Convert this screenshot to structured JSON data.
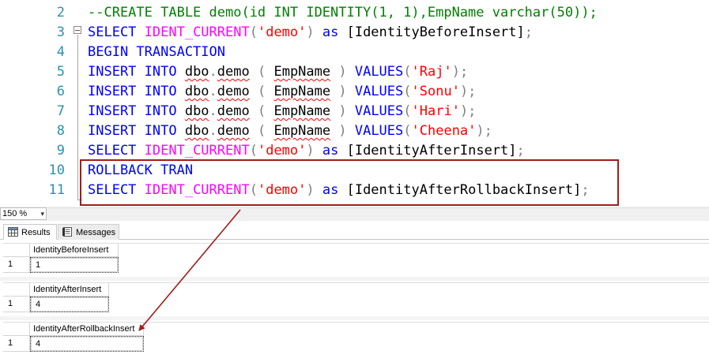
{
  "editor": {
    "lines": [
      {
        "num": "2",
        "tokens": [
          {
            "t": "--CREATE TABLE demo(id INT IDENTITY(1, 1),EmpName varchar(50));",
            "c": "cm"
          }
        ]
      },
      {
        "num": "3",
        "tokens": [
          {
            "t": "SELECT ",
            "c": "kw"
          },
          {
            "t": "IDENT_CURRENT",
            "c": "fn"
          },
          {
            "t": "(",
            "c": "op"
          },
          {
            "t": "'demo'",
            "c": "str"
          },
          {
            "t": ") ",
            "c": "op"
          },
          {
            "t": "as ",
            "c": "kw"
          },
          {
            "t": "[IdentityBeforeInsert]",
            "c": ""
          },
          {
            "t": ";",
            "c": "op"
          }
        ]
      },
      {
        "num": "4",
        "tokens": [
          {
            "t": "BEGIN TRANSACTION",
            "c": "kw"
          }
        ]
      },
      {
        "num": "5",
        "tokens": [
          {
            "t": "INSERT INTO ",
            "c": "kw"
          },
          {
            "t": "dbo",
            "c": "sq"
          },
          {
            "t": ".",
            "c": "op"
          },
          {
            "t": "demo",
            "c": "sq"
          },
          {
            "t": " ( ",
            "c": "op"
          },
          {
            "t": "EmpName",
            "c": "sq"
          },
          {
            "t": " ) ",
            "c": "op"
          },
          {
            "t": "VALUES",
            "c": "kw"
          },
          {
            "t": "(",
            "c": "op"
          },
          {
            "t": "'Raj'",
            "c": "str"
          },
          {
            "t": ");",
            "c": "op"
          }
        ]
      },
      {
        "num": "6",
        "tokens": [
          {
            "t": "INSERT INTO ",
            "c": "kw"
          },
          {
            "t": "dbo",
            "c": "sq"
          },
          {
            "t": ".",
            "c": "op"
          },
          {
            "t": "demo",
            "c": "sq"
          },
          {
            "t": " ( ",
            "c": "op"
          },
          {
            "t": "EmpName",
            "c": "sq"
          },
          {
            "t": " ) ",
            "c": "op"
          },
          {
            "t": "VALUES",
            "c": "kw"
          },
          {
            "t": "(",
            "c": "op"
          },
          {
            "t": "'Sonu'",
            "c": "str"
          },
          {
            "t": ");",
            "c": "op"
          }
        ]
      },
      {
        "num": "7",
        "tokens": [
          {
            "t": "INSERT INTO ",
            "c": "kw"
          },
          {
            "t": "dbo",
            "c": "sq"
          },
          {
            "t": ".",
            "c": "op"
          },
          {
            "t": "demo",
            "c": "sq"
          },
          {
            "t": " ( ",
            "c": "op"
          },
          {
            "t": "EmpName",
            "c": "sq"
          },
          {
            "t": " ) ",
            "c": "op"
          },
          {
            "t": "VALUES",
            "c": "kw"
          },
          {
            "t": "(",
            "c": "op"
          },
          {
            "t": "'Hari'",
            "c": "str"
          },
          {
            "t": ");",
            "c": "op"
          }
        ]
      },
      {
        "num": "8",
        "tokens": [
          {
            "t": "INSERT INTO ",
            "c": "kw"
          },
          {
            "t": "dbo",
            "c": "sq"
          },
          {
            "t": ".",
            "c": "op"
          },
          {
            "t": "demo",
            "c": "sq"
          },
          {
            "t": " ( ",
            "c": "op"
          },
          {
            "t": "EmpName",
            "c": "sq"
          },
          {
            "t": " ) ",
            "c": "op"
          },
          {
            "t": "VALUES",
            "c": "kw"
          },
          {
            "t": "(",
            "c": "op"
          },
          {
            "t": "'Cheena'",
            "c": "str"
          },
          {
            "t": ");",
            "c": "op"
          }
        ]
      },
      {
        "num": "9",
        "tokens": [
          {
            "t": "SELECT ",
            "c": "kw"
          },
          {
            "t": "IDENT_CURRENT",
            "c": "fn"
          },
          {
            "t": "(",
            "c": "op"
          },
          {
            "t": "'demo'",
            "c": "str"
          },
          {
            "t": ") ",
            "c": "op"
          },
          {
            "t": "as ",
            "c": "kw"
          },
          {
            "t": "[IdentityAfterInsert]",
            "c": ""
          },
          {
            "t": ";",
            "c": "op"
          }
        ]
      },
      {
        "num": "10",
        "tokens": [
          {
            "t": "ROLLBACK TRAN",
            "c": "kw"
          }
        ]
      },
      {
        "num": "11",
        "tokens": [
          {
            "t": "SELECT ",
            "c": "kw"
          },
          {
            "t": "IDENT_CURRENT",
            "c": "fn"
          },
          {
            "t": "(",
            "c": "op"
          },
          {
            "t": "'demo'",
            "c": "str"
          },
          {
            "t": ") ",
            "c": "op"
          },
          {
            "t": "as ",
            "c": "kw"
          },
          {
            "t": "[IdentityAfterRollbackInsert]",
            "c": ""
          },
          {
            "t": ";",
            "c": "op"
          }
        ]
      }
    ]
  },
  "zoom": {
    "value": "150 %"
  },
  "tabs": {
    "results": "Results",
    "messages": "Messages"
  },
  "grids": [
    {
      "header": "IdentityBeforeInsert",
      "row": "1",
      "value": "1"
    },
    {
      "header": "IdentityAfterInsert",
      "row": "1",
      "value": "4"
    },
    {
      "header": "IdentityAfterRollbackInsert",
      "row": "1",
      "value": "4"
    }
  ],
  "colors": {
    "keyword": "#0000ff",
    "function": "#ff00ff",
    "string": "#ff0000",
    "comment": "#008000",
    "annotation": "#a21c1c",
    "line_number": "#2b91af"
  }
}
